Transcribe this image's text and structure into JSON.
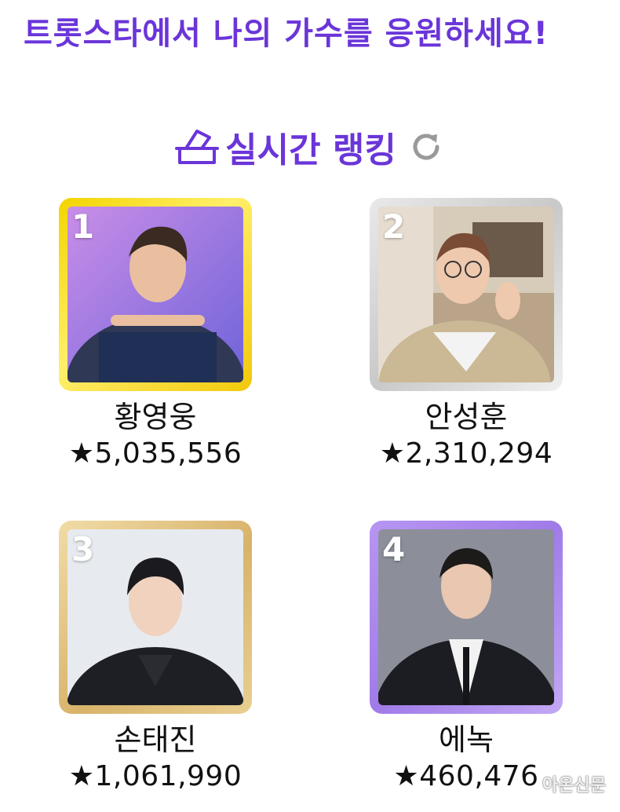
{
  "headline": "트롯스타에서 나의 가수를 응원하세요!",
  "section": {
    "title": "실시간 랭킹",
    "icon": "vote-box-icon",
    "refresh_icon": "refresh-icon"
  },
  "ranking": [
    {
      "rank": "1",
      "name": "황영웅",
      "votes": "★5,035,556",
      "frame": "gold"
    },
    {
      "rank": "2",
      "name": "안성훈",
      "votes": "★2,310,294",
      "frame": "silver"
    },
    {
      "rank": "3",
      "name": "손태진",
      "votes": "★1,061,990",
      "frame": "bronze"
    },
    {
      "rank": "4",
      "name": "에녹",
      "votes": "★460,476",
      "frame": "purple"
    }
  ],
  "watermark": "아온신문",
  "colors": {
    "accent": "#6a35d9",
    "gold": "#f3d400",
    "silver": "#d0d0d0",
    "bronze": "#dcb872",
    "purple": "#ab86ee"
  }
}
